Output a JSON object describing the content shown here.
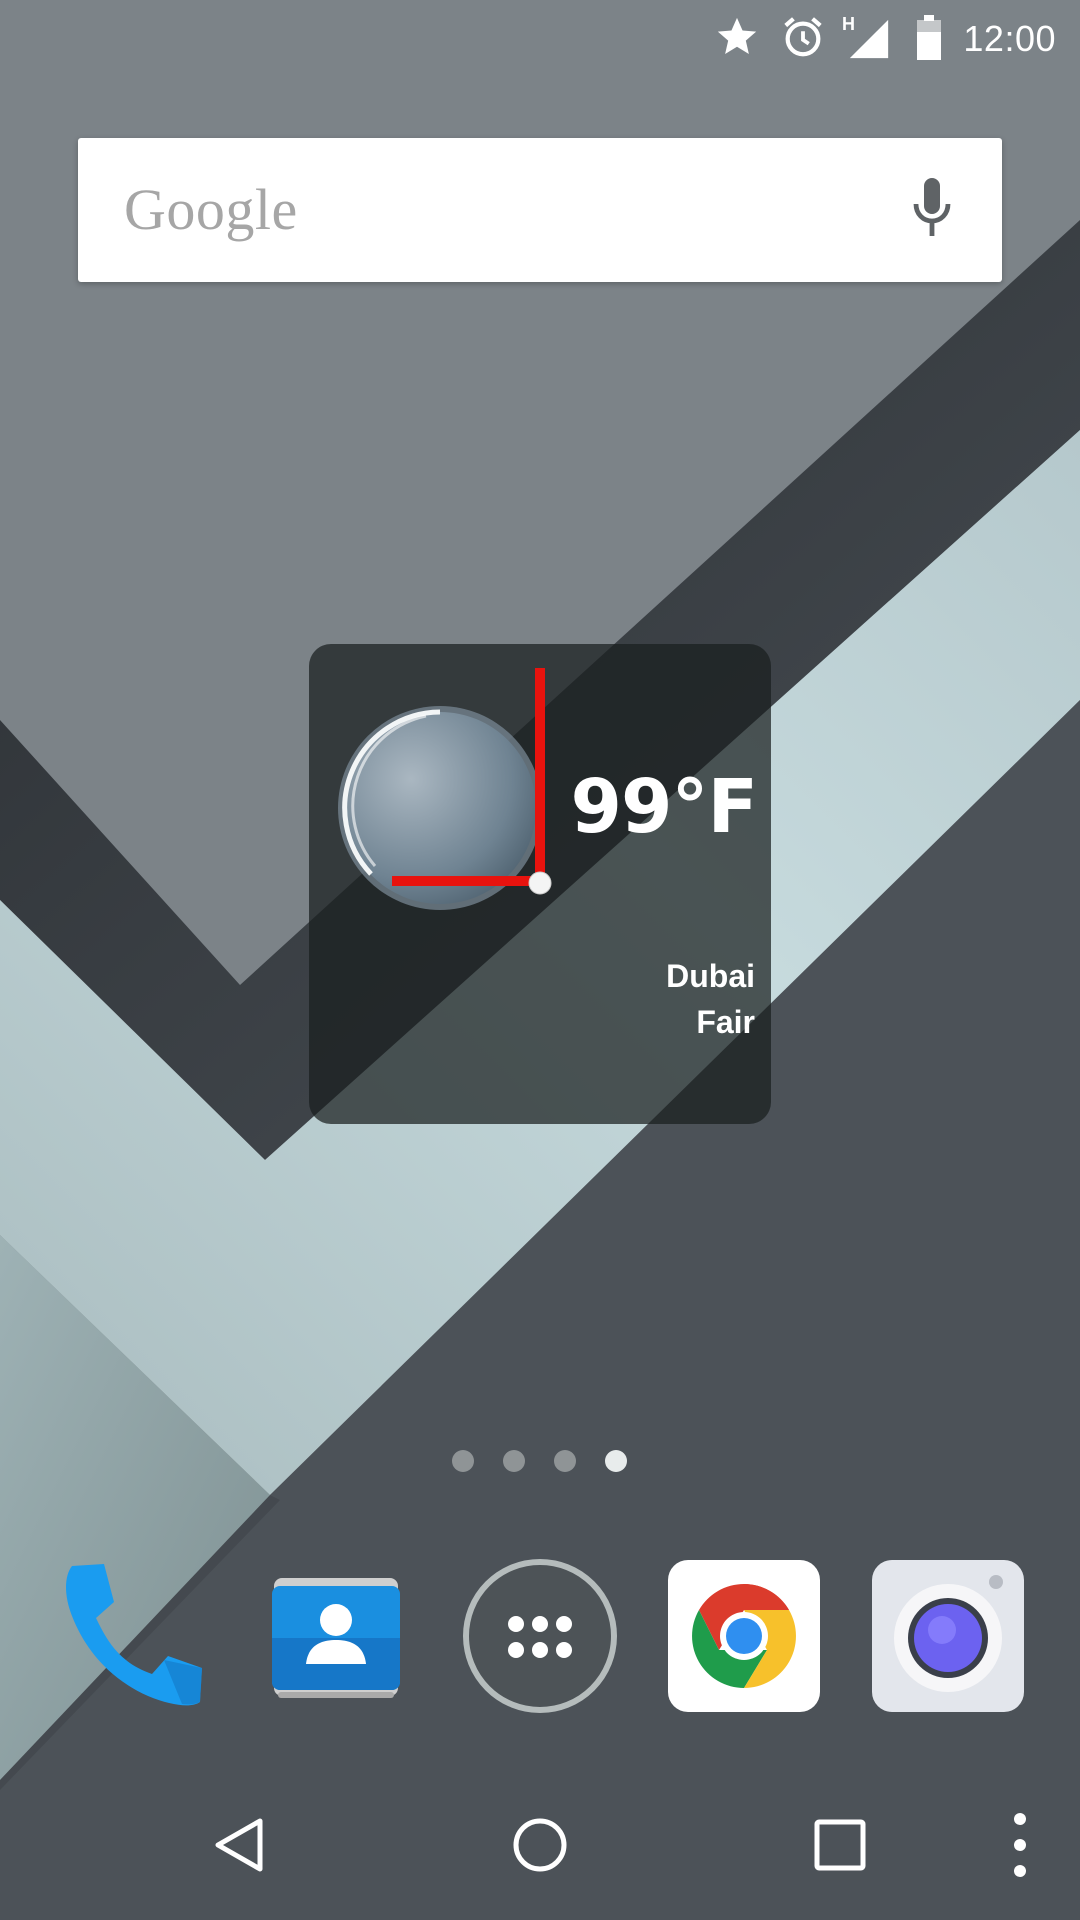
{
  "status_bar": {
    "time": "12:00",
    "network_label": "H",
    "icons": [
      "star-icon",
      "alarm-icon",
      "signal-icon",
      "battery-icon"
    ]
  },
  "search": {
    "logo_text": "Google",
    "icon": "mic-icon"
  },
  "weather_widget": {
    "temperature": "99°F",
    "city": "Dubai",
    "condition": "Fair",
    "icon": "clear-night-icon"
  },
  "page_indicator": {
    "total_pages": 4,
    "active_index": 3
  },
  "dock": {
    "apps": [
      {
        "name": "Phone",
        "icon": "phone-icon"
      },
      {
        "name": "Contacts",
        "icon": "contacts-icon"
      },
      {
        "name": "All apps",
        "icon": "app-drawer-icon"
      },
      {
        "name": "Chrome",
        "icon": "chrome-icon"
      },
      {
        "name": "Camera",
        "icon": "camera-icon"
      }
    ]
  },
  "nav_bar": {
    "buttons": [
      "back-icon",
      "home-icon",
      "recents-icon",
      "overflow-menu-icon"
    ]
  },
  "colors": {
    "accent_red": "#e8130e",
    "phone_blue": "#1a9cf0",
    "widget_bg": "#1d2222"
  }
}
